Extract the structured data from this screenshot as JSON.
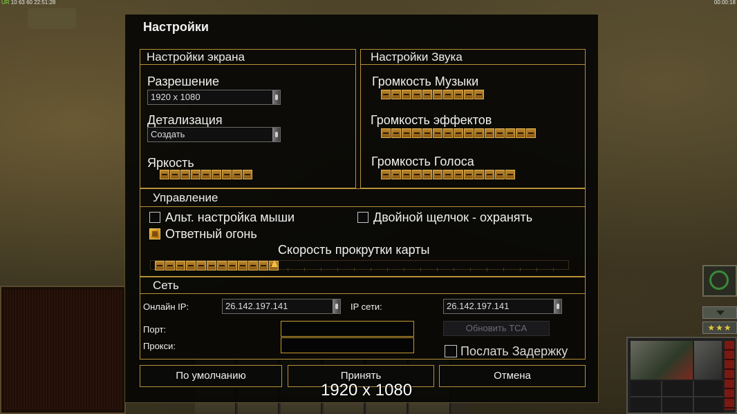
{
  "top_overlay": {
    "left_prefix": "UR",
    "left_fps": "10",
    "left_val": "63",
    "left_bracket": "60",
    "left_time": "22:51:28",
    "right_time": "00:00:18"
  },
  "dialog": {
    "title": "Настройки",
    "screen": {
      "header": "Настройки экрана",
      "resolution_label": "Разрешение",
      "resolution_value": "1920 x 1080",
      "detail_label": "Детализация",
      "detail_value": "Создать",
      "brightness_label": "Яркость",
      "brightness_level": 0.5
    },
    "sound": {
      "header": "Настройки Звука",
      "music_label": "Громкость Музыки",
      "music_level": 0.5,
      "effects_label": "Громкость эффектов",
      "effects_level": 0.75,
      "voice_label": "Громкость Голоса",
      "voice_level": 0.65
    },
    "control": {
      "header": "Управление",
      "alt_mouse_label": "Альт. настройка мыши",
      "alt_mouse_checked": false,
      "double_click_label": "Двойной щелчок - охранять",
      "double_click_checked": false,
      "return_fire_label": "Ответный огонь",
      "return_fire_checked": true,
      "scroll_speed_label": "Скорость прокрутки карты",
      "scroll_speed_level": 0.3
    },
    "network": {
      "header": "Сеть",
      "online_ip_label": "Онлайн IP:",
      "online_ip_value": "26.142.197.141",
      "net_ip_label": "IP сети:",
      "net_ip_value": "26.142.197.141",
      "port_label": "Порт:",
      "port_value": "",
      "proxy_label": "Прокси:",
      "proxy_value": "",
      "update_tca_label": "Обновить TCA",
      "send_delay_label": "Послать Задержку",
      "send_delay_checked": false
    },
    "buttons": {
      "default": "По умолчанию",
      "accept": "Принять",
      "cancel": "Отмена"
    }
  },
  "overlay": {
    "resolution_text": "1920 x 1080"
  },
  "hud": {
    "stars": "★★★"
  },
  "colors": {
    "accent": "#b89238",
    "slider": "#b8832a",
    "checkbox_on": "#f2b42c"
  }
}
